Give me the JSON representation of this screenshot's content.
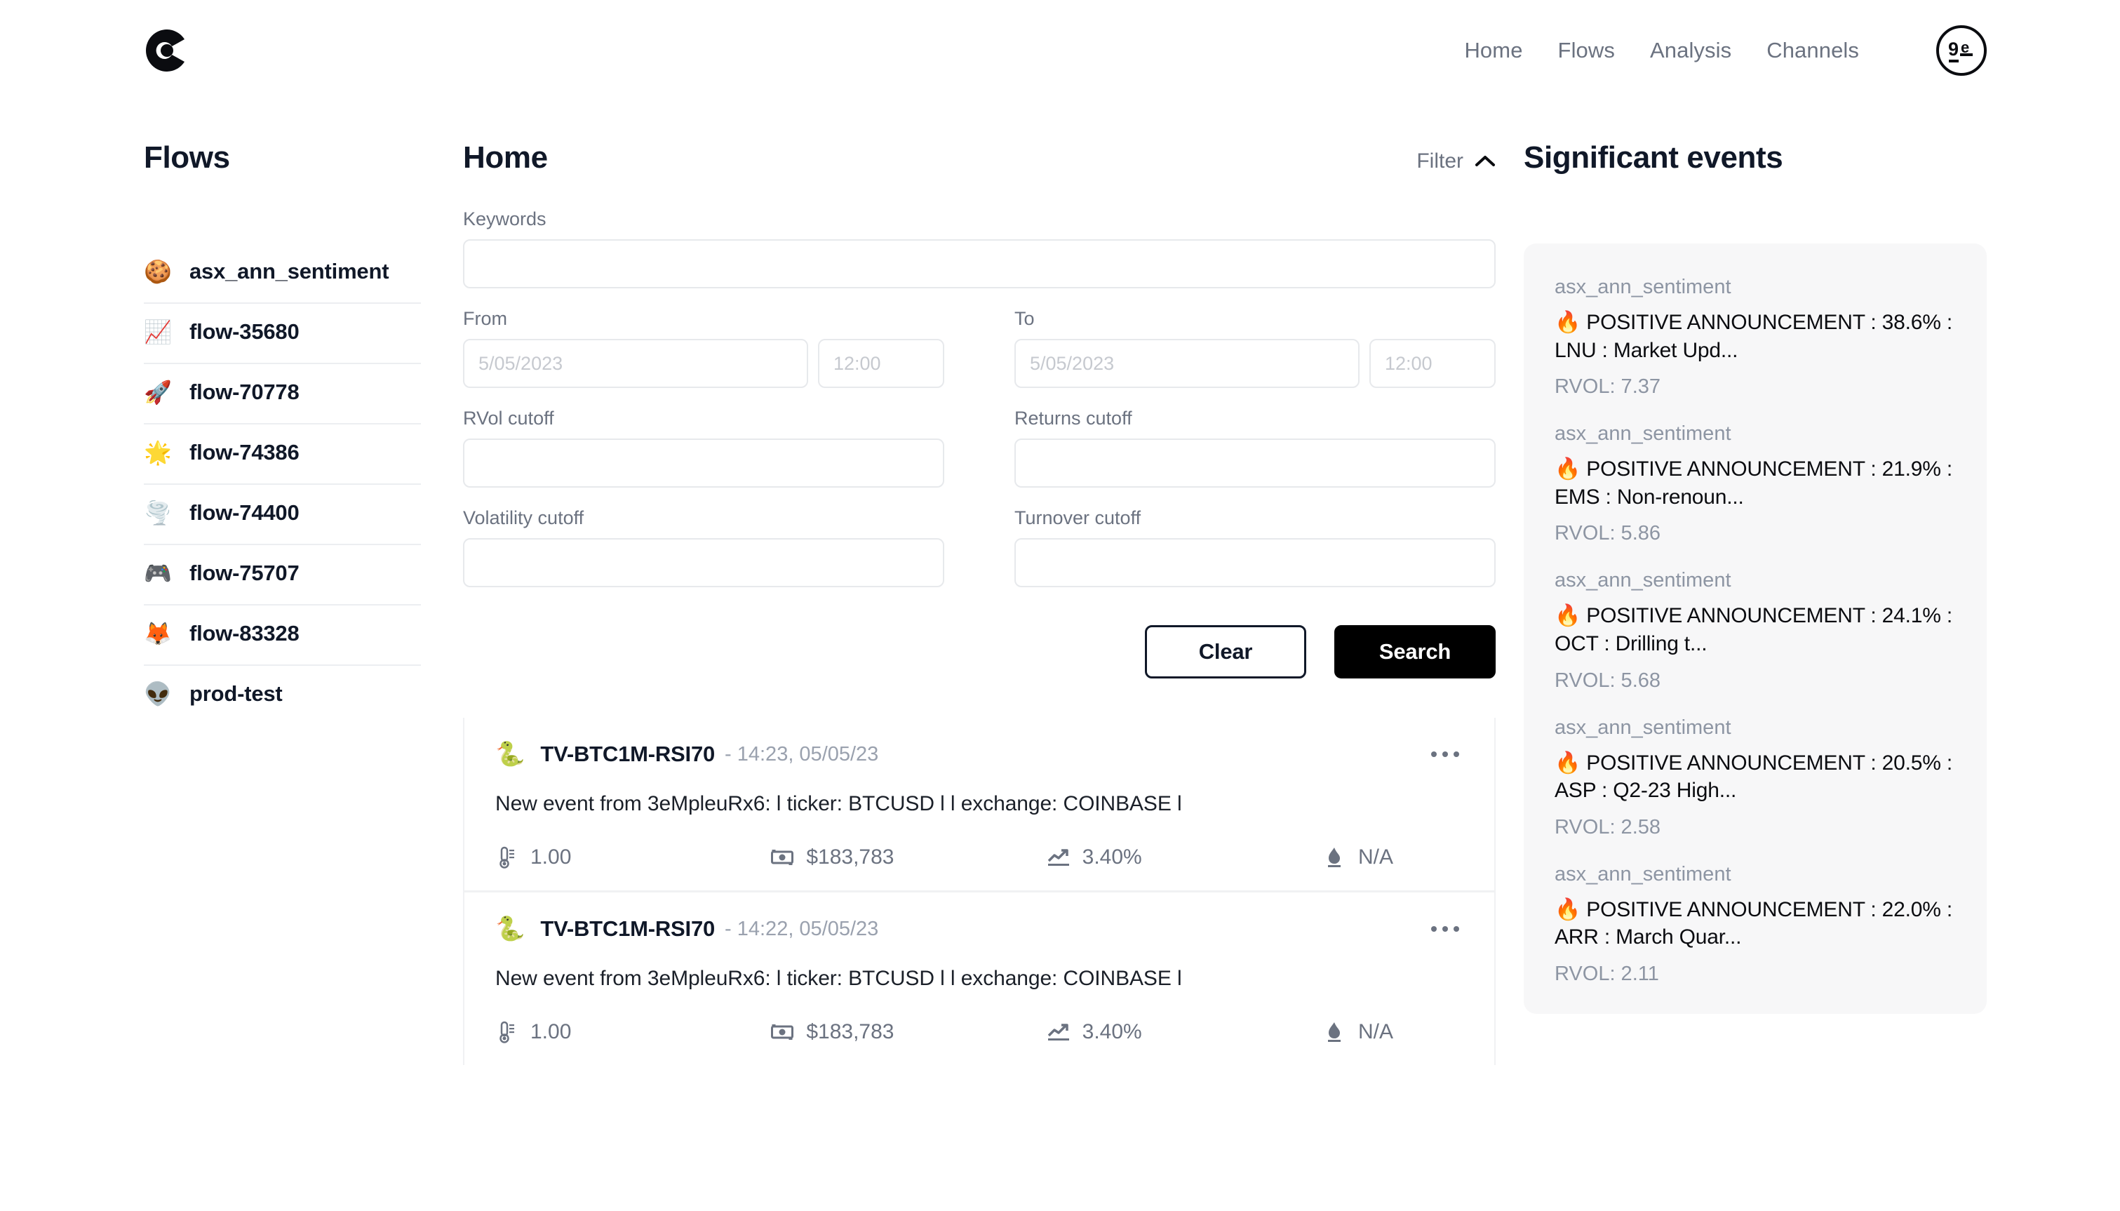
{
  "header": {
    "logo_icon": "coral-c-logo",
    "nav": [
      {
        "label": "Home"
      },
      {
        "label": "Flows"
      },
      {
        "label": "Analysis"
      },
      {
        "label": "Channels"
      }
    ],
    "avatar_text": "9e"
  },
  "sidebar": {
    "title": "Flows",
    "items": [
      {
        "emoji": "🍪",
        "icon": "cookie-icon",
        "label": "asx_ann_sentiment"
      },
      {
        "emoji": "📈",
        "icon": "chart-increasing-icon",
        "label": "flow-35680"
      },
      {
        "emoji": "🚀",
        "icon": "rocket-icon",
        "label": "flow-70778"
      },
      {
        "emoji": "🌟",
        "icon": "glowing-star-icon",
        "label": "flow-74386"
      },
      {
        "emoji": "🌪️",
        "icon": "tornado-icon",
        "label": "flow-74400"
      },
      {
        "emoji": "🎮",
        "icon": "video-game-icon",
        "label": "flow-75707"
      },
      {
        "emoji": "🦊",
        "icon": "fox-icon",
        "label": "flow-83328"
      },
      {
        "emoji": "👽",
        "icon": "alien-icon",
        "label": "prod-test"
      }
    ]
  },
  "main": {
    "title": "Home",
    "filter": {
      "label": "Filter",
      "chevron": "chevron-up-icon"
    },
    "form": {
      "keywords": {
        "label": "Keywords",
        "value": "",
        "placeholder": ""
      },
      "from": {
        "label": "From",
        "date_value": "",
        "date_placeholder": "5/05/2023",
        "time_value": "",
        "time_placeholder": "12:00"
      },
      "to": {
        "label": "To",
        "date_value": "",
        "date_placeholder": "5/05/2023",
        "time_value": "",
        "time_placeholder": "12:00"
      },
      "rvol": {
        "label": "RVol cutoff",
        "value": "",
        "placeholder": ""
      },
      "returns": {
        "label": "Returns cutoff",
        "value": "",
        "placeholder": ""
      },
      "volatility": {
        "label": "Volatility cutoff",
        "value": "",
        "placeholder": ""
      },
      "turnover": {
        "label": "Turnover cutoff",
        "value": "",
        "placeholder": ""
      },
      "clear_label": "Clear",
      "search_label": "Search"
    },
    "events": [
      {
        "emoji": "🐍",
        "title": "TV-BTC1M-RSI70",
        "time": "- 14:23, 05/05/23",
        "body": "New event from 3eMpleuRx6: l ticker: BTCUSD l l exchange: COINBASE l",
        "metrics": [
          {
            "icon": "thermometer-icon",
            "value": "1.00"
          },
          {
            "icon": "money-bill-icon",
            "value": "$183,783"
          },
          {
            "icon": "chart-line-up-icon",
            "value": "3.40%"
          },
          {
            "icon": "flame-icon",
            "value": "N/A"
          }
        ]
      },
      {
        "emoji": "🐍",
        "title": "TV-BTC1M-RSI70",
        "time": "- 14:22, 05/05/23",
        "body": "New event from 3eMpleuRx6: l ticker: BTCUSD l l exchange: COINBASE l",
        "metrics": [
          {
            "icon": "thermometer-icon",
            "value": "1.00"
          },
          {
            "icon": "money-bill-icon",
            "value": "$183,783"
          },
          {
            "icon": "chart-line-up-icon",
            "value": "3.40%"
          },
          {
            "icon": "flame-icon",
            "value": "N/A"
          }
        ]
      }
    ]
  },
  "significant_events": {
    "title": "Significant events",
    "items": [
      {
        "source": "asx_ann_sentiment",
        "emoji": "🔥",
        "headline": "POSITIVE ANNOUNCEMENT : 38.6% : LNU : Market Upd...",
        "rvol": "RVOL: 7.37"
      },
      {
        "source": "asx_ann_sentiment",
        "emoji": "🔥",
        "headline": "POSITIVE ANNOUNCEMENT : 21.9% : EMS : Non-renoun...",
        "rvol": "RVOL: 5.86"
      },
      {
        "source": "asx_ann_sentiment",
        "emoji": "🔥",
        "headline": "POSITIVE ANNOUNCEMENT : 24.1% : OCT : Drilling t...",
        "rvol": "RVOL: 5.68"
      },
      {
        "source": "asx_ann_sentiment",
        "emoji": "🔥",
        "headline": "POSITIVE ANNOUNCEMENT : 20.5% : ASP : Q2-23 High...",
        "rvol": "RVOL: 2.58"
      },
      {
        "source": "asx_ann_sentiment",
        "emoji": "🔥",
        "headline": "POSITIVE ANNOUNCEMENT : 22.0% : ARR : March Quar...",
        "rvol": "RVOL: 2.11"
      }
    ]
  },
  "colors": {
    "accent": "#000000",
    "text_primary": "#101828",
    "text_muted": "#6b7280",
    "panel_bg": "#f7f7f8",
    "border": "#e7e9ec"
  }
}
